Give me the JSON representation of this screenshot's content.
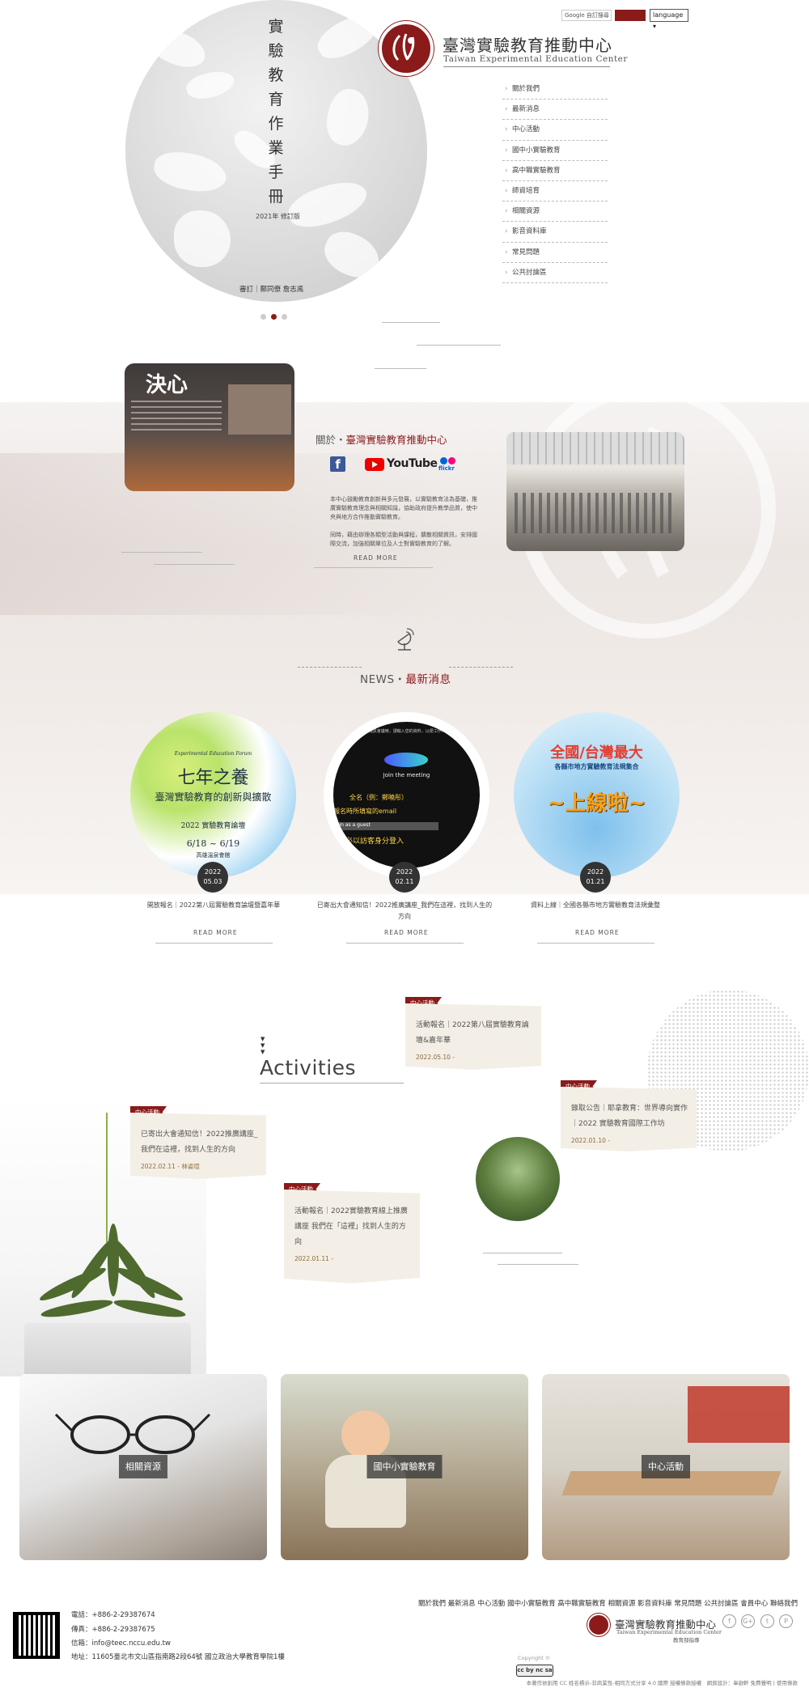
{
  "header": {
    "google_label": "Google 自訂搜尋",
    "language_label": "language",
    "logo_cn": "臺灣實驗教育推動中心",
    "logo_en": "Taiwan Experimental Education Center"
  },
  "hero": {
    "title": "實驗教育作業手冊",
    "edition": "2021年 修訂版",
    "authors": "審訂｜鄭同僚  詹志禹"
  },
  "nav": [
    "關於我們",
    "最新消息",
    "中心活動",
    "國中小實驗教育",
    "高中職實驗教育",
    "師資培育",
    "相關資源",
    "影音資料庫",
    "常見問題",
    "公共討論區"
  ],
  "about": {
    "photo_title": "決心",
    "title_pre": "關於・",
    "title_main": "臺灣實驗教育推動中心",
    "youtube_label": "YouTube",
    "flickr_label": "flickr",
    "para1": "本中心鼓勵教育創新與多元發展，以實驗教育法為基礎，推廣實驗教育理念與相關知識，協助政府提升教學品質，使中央與地方合作推動實驗教育。",
    "para2": "同時，藉由辦理各類型活動與課程，擴散相關資訊，安排國際交流，加強相關單位及人士對實驗教育的了解。",
    "read_more": "READ MORE"
  },
  "news": {
    "title_pre": "NEWS・",
    "title_main": "最新消息",
    "items": [
      {
        "caption": "開放報名｜2022第八屆實驗教育論壇暨嘉年華",
        "year": "2022",
        "date": "05.03",
        "img_subtitle": "Experimental Education Forum",
        "img_title": "七年之養",
        "img_sub2": "臺灣實驗教育的創新與擴散",
        "img_event": "2022 實驗教育論壇",
        "img_dates": "6/18 ~ 6/19",
        "img_place": "高雄溫泉會館"
      },
      {
        "caption": "已寄出大會通知信！2022推廣講座_我們在這裡，找到人生的方向",
        "year": "2022",
        "date": "02.11",
        "img_top": "＊ 進入視訊會議時，請輸入您的資料，以便工作人員確認",
        "img_meeting": "Join the meeting",
        "img_name": "全名（例：鄭曉彤）",
        "img_email": "報名時所填寫的email",
        "img_join": "Join as a guest",
        "img_hint": "務必以訪客身分登入"
      },
      {
        "caption": "資料上線｜全國各縣市地方實驗教育法規彙整",
        "year": "2022",
        "date": "01.21",
        "img_title": "全國/台灣最大",
        "img_sub": "各縣市地方實驗教育法規集合",
        "img_big": "~上線啦~"
      }
    ],
    "read_more": "READ MORE"
  },
  "activities": {
    "heading": "Activities",
    "tag": "中心活動",
    "cards": [
      {
        "text": "活動報名｜2022第八屆實驗教育論壇&嘉年華",
        "date": "2022.05.10 -"
      },
      {
        "text": "錄取公告｜耶拿教育：世界導向實作｜2022 實驗教育國際工作坊",
        "date": "2022.01.10 -"
      },
      {
        "text": "已寄出大會通知信！2022推廣講座_我們在這裡，找到人生的方向",
        "date": "2022.02.11 - 林姿瑄"
      },
      {
        "text": "活動報名｜2022實驗教育線上推廣講座 我們在「這裡」找到人生的方向",
        "date": "2022.01.11 -"
      }
    ]
  },
  "tiles": [
    "相關資源",
    "國中小實驗教育",
    "中心活動"
  ],
  "footer": {
    "phone": "電話：+886-2-29387674",
    "fax": "傳真：+886-2-29387675",
    "email": "信箱：info@teec.nccu.edu.tw",
    "address": "地址：11605臺北市文山區指南路2段64號 國立政治大學教育學院1樓",
    "nav": "關於我們 最新消息 中心活動 國中小實驗教育 高中職實驗教育 相關資源 影音資料庫 常見問題 公共討論區 會員中心 聯絡我們",
    "logo_cn": "臺灣實驗教育推動中心",
    "logo_en": "Taiwan Experimental Education Center",
    "ministry": "教育部指導",
    "copyright": "Copyright ©",
    "cc": "cc by nc sa",
    "license": "本著作依創用 CC 姓名標示-非商業性-相同方式分享 4.0 國際 授權條款授權　網頁設計：韋啟軒 免費聲明 | 使用條款",
    "social": [
      "f",
      "G+",
      "t",
      "P"
    ]
  }
}
